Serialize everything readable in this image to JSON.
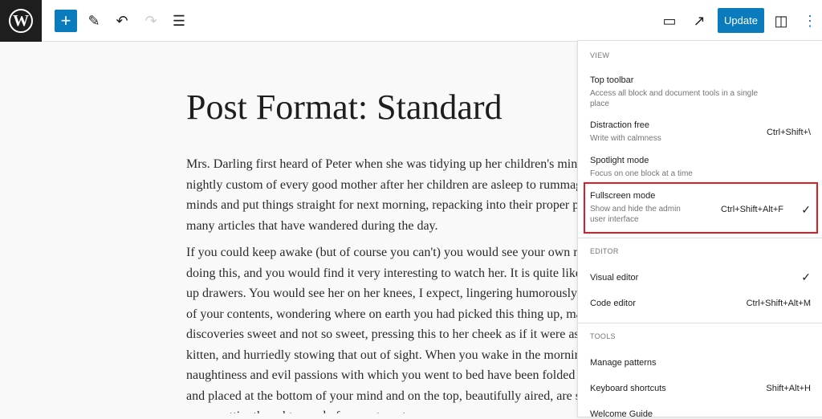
{
  "toolbar": {
    "logo": "W",
    "add": "+",
    "pen": "✎",
    "undo": "↶",
    "redo": "↷",
    "list": "☰",
    "view": "▭",
    "preview": "↗",
    "update": "Update",
    "settings": "◫",
    "options": "⋮"
  },
  "post": {
    "title": "Post Format: Standard",
    "lines": [
      "Mrs. Darling first heard of Peter when she was tidying up her children's minds",
      "nightly custom of every good mother after her children are asleep to rummage",
      "minds and put things straight for next morning, repacking into their proper pl",
      "many articles that have wandered during the day.",
      "If you could keep awake (but of course you can't) you would see your own m",
      "doing this, and you would find it very interesting to watch her. It is quite like",
      "up drawers. You would see her on her knees, I expect, lingering humorously o",
      "of your contents, wondering where on earth you had picked this thing up, ma",
      "discoveries sweet and not so sweet, pressing this to her cheek as if it were as ni",
      "kitten, and hurriedly stowing that out of sight. When you wake in the mornin",
      "naughtiness and evil passions with which you went to bed have been folded up",
      "and placed at the bottom of your mind and on the top, beautifully aired, are sp",
      "your prettier thoughts, ready for you to put on."
    ]
  },
  "menu": {
    "view": "VIEW",
    "editor": "EDITOR",
    "tools": "TOOLS",
    "top_toolbar": {
      "label": "Top toolbar",
      "desc": "Access all block and document tools in a single place"
    },
    "distraction": {
      "label": "Distraction free",
      "desc": "Write with calmness",
      "shortcut": "Ctrl+Shift+\\"
    },
    "spotlight": {
      "label": "Spotlight mode",
      "desc": "Focus on one block at a time"
    },
    "fullscreen": {
      "label": "Fullscreen mode",
      "desc": "Show and hide the admin user interface",
      "shortcut": "Ctrl+Shift+Alt+F",
      "check": "✓"
    },
    "visual": {
      "label": "Visual editor",
      "check": "✓"
    },
    "code": {
      "label": "Code editor",
      "shortcut": "Ctrl+Shift+Alt+M"
    },
    "patterns": {
      "label": "Manage patterns"
    },
    "keyboard": {
      "label": "Keyboard shortcuts",
      "shortcut": "Shift+Alt+H"
    },
    "welcome": {
      "label": "Welcome Guide"
    }
  },
  "colors": {
    "accent": "#0a7bbd",
    "highlight": "#e01b24"
  }
}
